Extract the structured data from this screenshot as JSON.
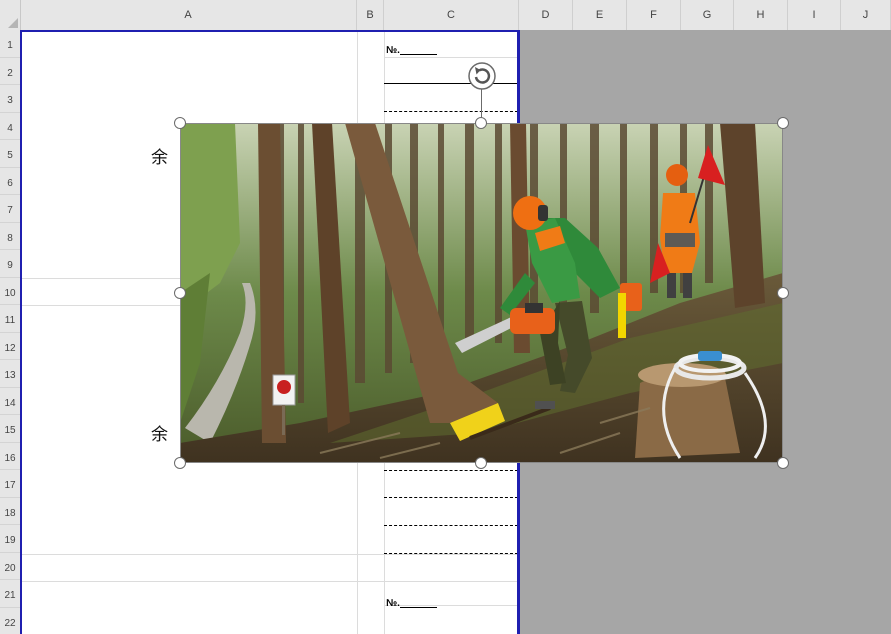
{
  "spreadsheet": {
    "columns": [
      "A",
      "B",
      "C",
      "D",
      "E",
      "F",
      "G",
      "H",
      "I",
      "J"
    ],
    "rows": [
      "1",
      "2",
      "3",
      "4",
      "5",
      "6",
      "7",
      "8",
      "9",
      "10",
      "11",
      "12",
      "13",
      "14",
      "15",
      "16",
      "17",
      "18",
      "19",
      "20",
      "21",
      "22"
    ]
  },
  "cells": {
    "no_label_1": "№.",
    "no_label_2": "№.",
    "margin_top": "余",
    "margin_bottom": "余"
  },
  "image": {
    "description_name": "forestry-worker-chainsaw-photo",
    "selected": true
  },
  "colors": {
    "print_border": "#1f1fb0",
    "outside_area": "#a6a6a6",
    "header_bg": "#e6e6e6"
  }
}
